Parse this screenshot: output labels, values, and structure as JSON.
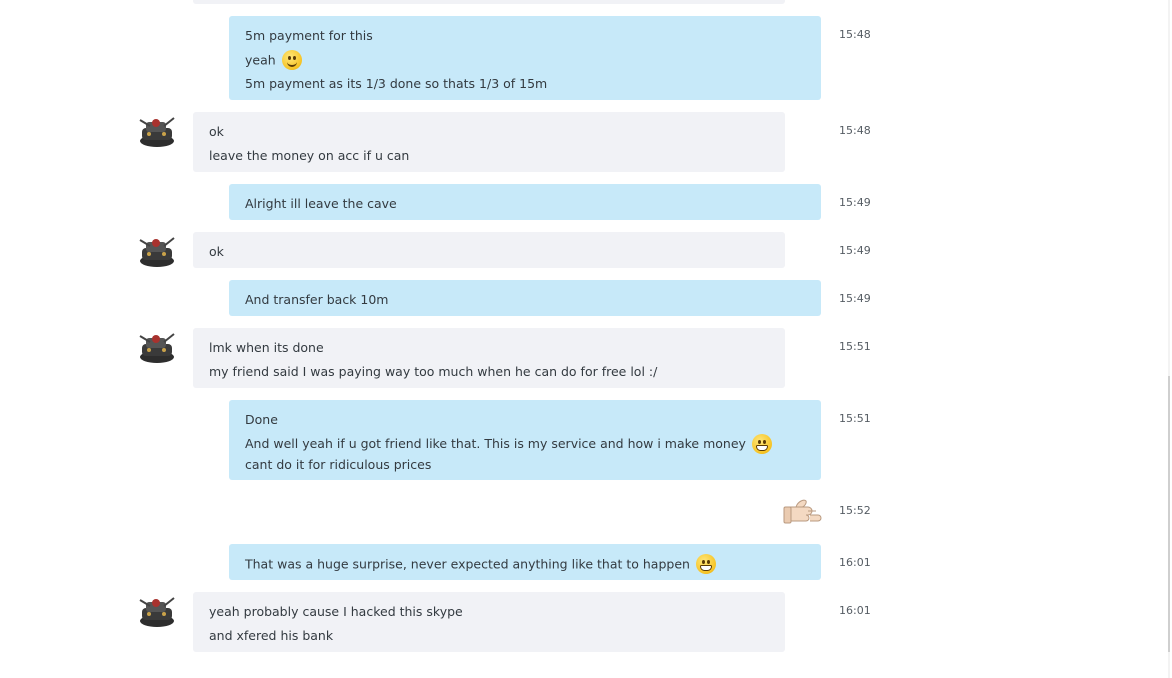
{
  "messages": [
    {
      "id": "m1",
      "dir": "out",
      "time": "15:48",
      "lines": [
        {
          "text": "5m payment for this"
        },
        {
          "text": "yeah",
          "emoji": "smile"
        },
        {
          "text": "5m payment as its 1/3 done so thats 1/3 of 15m"
        }
      ]
    },
    {
      "id": "m2",
      "dir": "in",
      "time": "15:48",
      "lines": [
        {
          "text": "ok"
        },
        {
          "text": "leave the money on acc if u can"
        }
      ]
    },
    {
      "id": "m3",
      "dir": "out",
      "time": "15:49",
      "lines": [
        {
          "text": "Alright ill leave the cave"
        }
      ]
    },
    {
      "id": "m4",
      "dir": "in",
      "time": "15:49",
      "lines": [
        {
          "text": "ok"
        }
      ]
    },
    {
      "id": "m5",
      "dir": "out",
      "time": "15:49",
      "lines": [
        {
          "text": "And transfer back 10m"
        }
      ]
    },
    {
      "id": "m6",
      "dir": "in",
      "time": "15:51",
      "lines": [
        {
          "text": "lmk when its done"
        },
        {
          "text": "my friend said I was paying way too much when he can do for free lol :/"
        }
      ]
    },
    {
      "id": "m7",
      "dir": "out",
      "time": "15:51",
      "lines": [
        {
          "text": "Done"
        },
        {
          "text": "And well yeah if u got friend like that. This is my service and how i make money",
          "emoji": "grin",
          "after": "cant do it for ridiculous prices"
        }
      ]
    },
    {
      "id": "m8",
      "dir": "out",
      "time": "15:52",
      "sticker": "thumbs-up-icon"
    },
    {
      "id": "m9",
      "dir": "out",
      "time": "16:01",
      "lines": [
        {
          "text": "That was a huge surprise, never expected anything like that to happen",
          "emoji": "grin"
        }
      ]
    },
    {
      "id": "m10",
      "dir": "in",
      "time": "16:01",
      "lines": [
        {
          "text": "yeah probably cause I hacked this skype"
        },
        {
          "text": "and xfered his bank"
        }
      ]
    }
  ],
  "colors": {
    "incoming": "#f1f2f6",
    "outgoing": "#c7e9f9",
    "text": "#333a40"
  },
  "icons": {
    "avatar": "contact-avatar-icon",
    "smile": "smile-emoji-icon",
    "grin": "grin-emoji-icon"
  }
}
